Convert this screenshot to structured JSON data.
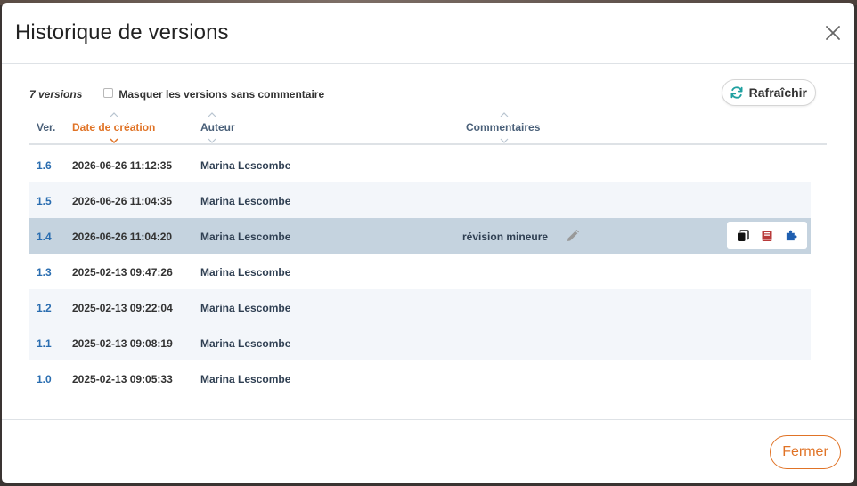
{
  "dialog": {
    "title": "Historique de versions",
    "close_icon": "close-icon"
  },
  "toolbar": {
    "count": "7 versions",
    "filter_label": "Masquer les versions sans commentaire",
    "filter_checked": false,
    "refresh_label": "Rafraîchir"
  },
  "table": {
    "columns": [
      {
        "key": "ver",
        "label": "Ver."
      },
      {
        "key": "date",
        "label": "Date de création",
        "sorted": "desc"
      },
      {
        "key": "author",
        "label": "Auteur"
      },
      {
        "key": "comment",
        "label": "Commentaires"
      }
    ],
    "rows": [
      {
        "ver": "1.6",
        "date": "2026-06-26 11:12:35",
        "author": "Marina Lescombe",
        "comment": ""
      },
      {
        "ver": "1.5",
        "date": "2026-06-26 11:04:35",
        "author": "Marina Lescombe",
        "comment": ""
      },
      {
        "ver": "1.4",
        "date": "2026-06-26 11:04:20",
        "author": "Marina Lescombe",
        "comment": "révision mineure",
        "selected": true
      },
      {
        "ver": "1.3",
        "date": "2025-02-13 09:47:26",
        "author": "Marina Lescombe",
        "comment": ""
      },
      {
        "ver": "1.2",
        "date": "2025-02-13 09:22:04",
        "author": "Marina Lescombe",
        "comment": ""
      },
      {
        "ver": "1.1",
        "date": "2025-02-13 09:08:19",
        "author": "Marina Lescombe",
        "comment": ""
      },
      {
        "ver": "1.0",
        "date": "2025-02-13 09:05:33",
        "author": "Marina Lescombe",
        "comment": ""
      }
    ],
    "row_actions": [
      "copy-icon",
      "book-icon",
      "puzzle-icon"
    ]
  },
  "footer": {
    "close_label": "Fermer"
  },
  "colors": {
    "accent": "#e07326",
    "link": "#2a6db0",
    "selected_row": "#c5d3df",
    "striped_row": "#f3f6fa",
    "refresh_icon": "#1fa0a0",
    "book_icon": "#b83a3a",
    "puzzle_icon": "#1f5fb0"
  }
}
